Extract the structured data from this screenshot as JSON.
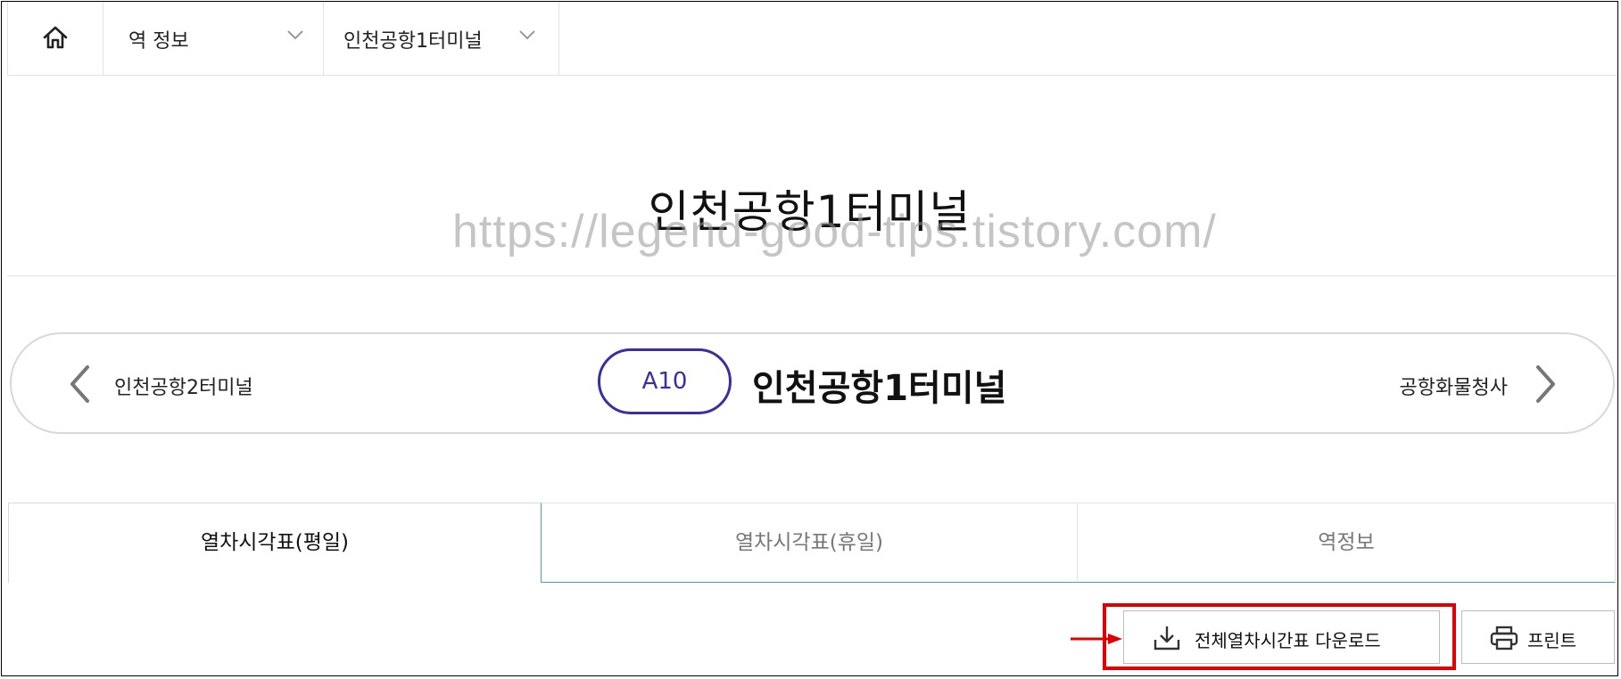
{
  "breadcrumb": {
    "home_icon": "home-icon",
    "items": [
      {
        "label": "역 정보",
        "icon": "chevron-down-icon"
      },
      {
        "label": "인천공항1터미널",
        "icon": "chevron-down-icon"
      }
    ]
  },
  "page": {
    "title": "인천공항1터미널",
    "watermark": "https://legend-good-tips.tistory.com/"
  },
  "station_nav": {
    "prev_station": "인천공항2터미널",
    "next_station": "공항화물청사",
    "code": "A10",
    "name": "인천공항1터미널",
    "code_color": "#3a2fa0"
  },
  "tabs": [
    {
      "label": "열차시각표(평일)",
      "active": true
    },
    {
      "label": "열차시각표(휴일)",
      "active": false
    },
    {
      "label": "역정보",
      "active": false
    }
  ],
  "actions": {
    "download_label": "전체열차시간표 다운로드",
    "download_icon": "download-icon",
    "print_label": "프린트",
    "print_icon": "printer-icon",
    "highlight_color": "#e00000"
  }
}
